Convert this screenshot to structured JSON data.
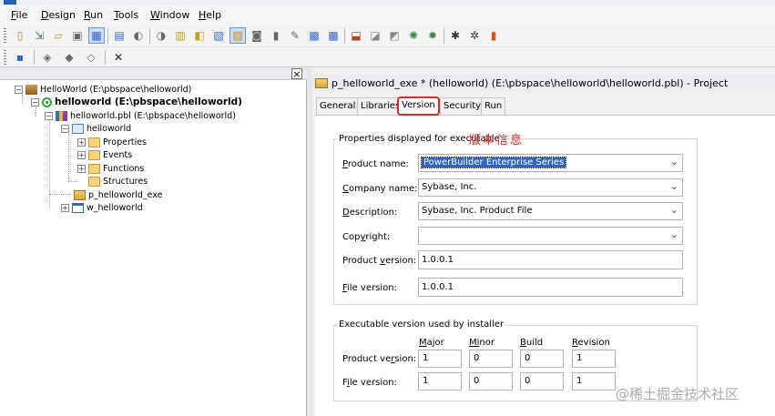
{
  "menu": [
    "File",
    "Design",
    "Run",
    "Tools",
    "Window",
    "Help"
  ],
  "menu_mnemonic": [
    "F",
    "D",
    "R",
    "T",
    "W",
    "H"
  ],
  "toolbar1_icons": [
    "new-icon",
    "inherit-icon",
    "open-icon",
    "preview-icon",
    "library-painter-icon",
    "system-tree-icon",
    "back-icon",
    "forward-icon",
    "script-icon",
    "object-icon",
    "properties-icon",
    "datawindow-icon",
    "database-icon",
    "document-icon",
    "edit-icon",
    "build-icon",
    "deploy-icon",
    "debug-icon",
    "layout-icon",
    "component-icon",
    "bug-icon",
    "profile-icon",
    "run-icon",
    "select-run-icon",
    "exit-icon"
  ],
  "toolbar2_icons": [
    "save-icon",
    "cut-object-icon",
    "import-icon",
    "export-icon",
    "close-icon"
  ],
  "tree": {
    "workspace": "HelloWorld (E:\\pbspace\\helloworld)",
    "target": "helloworld (E:\\pbspace\\helloworld)",
    "library": "helloworld.pbl (E:\\pbspace\\helloworld)",
    "app": "helloworld",
    "properties": "Properties",
    "events": "Events",
    "functions": "Functions",
    "structures": "Structures",
    "project": "p_helloworld_exe",
    "window": "w_helloworld"
  },
  "painter_title": "p_helloworld_exe * (helloworld) (E:\\pbspace\\helloworld\\helloworld.pbl) - Project",
  "tabs": [
    "General",
    "Libraries",
    "Version",
    "Security",
    "Run"
  ],
  "selected_tab": "Version",
  "props_group_title": "Properties displayed for executable",
  "annotation": "版本信息",
  "fields": {
    "product_name": {
      "label_pre": "",
      "label_u": "P",
      "label_post": "roduct name:",
      "value": "PowerBuilder Enterprise Series"
    },
    "company_name": {
      "label_pre": "",
      "label_u": "C",
      "label_post": "ompany name:",
      "value": "Sybase, Inc."
    },
    "description": {
      "label_pre": "",
      "label_u": "D",
      "label_post": "escription:",
      "value": "Sybase, Inc. Product File"
    },
    "copyright": {
      "label_pre": "Cop",
      "label_u": "y",
      "label_post": "right:",
      "value": ""
    },
    "product_version": {
      "label_pre": "Product ",
      "label_u": "v",
      "label_post": "ersion:",
      "value": "1.0.0.1"
    },
    "file_version": {
      "label_pre": "",
      "label_u": "F",
      "label_post": "ile version:",
      "value": "1.0.0.1"
    }
  },
  "installer_group_title": "Executable version used by installer",
  "installer_columns": [
    {
      "pre": "",
      "u": "M",
      "post": "ajor"
    },
    {
      "pre": "",
      "u": "Mi",
      "post": "nor"
    },
    {
      "pre": "",
      "u": "B",
      "post": "uild"
    },
    {
      "pre": "",
      "u": "R",
      "post": "evision"
    }
  ],
  "installer_rows": [
    {
      "label_pre": "Product ve",
      "label_u": "r",
      "label_post": "sion:",
      "values": [
        "1",
        "0",
        "0",
        "1"
      ]
    },
    {
      "label_pre": "F",
      "label_u": "i",
      "label_post": "le version:",
      "values": [
        "1",
        "0",
        "0",
        "1"
      ]
    }
  ],
  "watermark": "@稀土掘金技术社区",
  "colors": {
    "accent": "#d2302b",
    "selection": "#2f66c6"
  }
}
